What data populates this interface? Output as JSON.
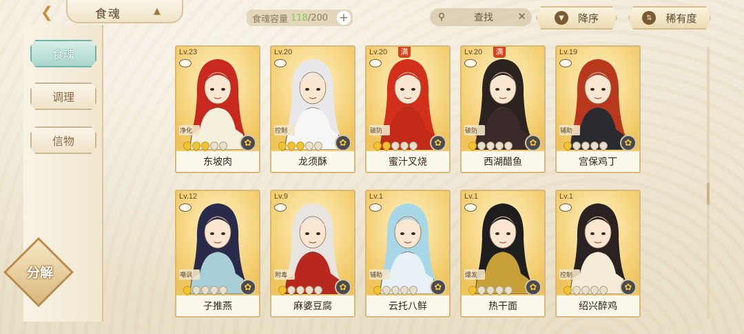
{
  "header": {
    "title": "食魂",
    "capacity_label": "食魂容量",
    "capacity_current": "118",
    "capacity_max": "/200",
    "capacity_add": "+",
    "search_label": "查找",
    "search_clear": "✕",
    "sort_order": "降序",
    "sort_by": "稀有度"
  },
  "sidebar": {
    "tabs": [
      {
        "label": "食魂",
        "active": true
      },
      {
        "label": "调理",
        "active": false
      },
      {
        "label": "信物",
        "active": false
      }
    ],
    "split_label": "分解"
  },
  "colors": {
    "accent_teal": "#a9d6cd",
    "gold": "#f0c866",
    "star_on": "#f1c234",
    "max_badge": "#d2431e",
    "capacity_current": "#8fc25a"
  },
  "cards": [
    {
      "level": "Lv.23",
      "full": "",
      "role": "净化",
      "stars": 3,
      "name": "东坡肉",
      "hair": "#c8281e",
      "outfit": "#f4f0dc"
    },
    {
      "level": "Lv.20",
      "full": "",
      "role": "控制",
      "stars": 3,
      "name": "龙须酥",
      "hair": "#e8e8ea",
      "outfit": "#f6f6f6"
    },
    {
      "level": "Lv.20",
      "full": "满",
      "role": "破防",
      "stars": 2,
      "name": "蜜汁叉烧",
      "hair": "#d2301c",
      "outfit": "#c42a1a"
    },
    {
      "level": "Lv.20",
      "full": "满",
      "role": "破防",
      "stars": 1,
      "name": "西湖醋鱼",
      "hair": "#2a2320",
      "outfit": "#3a2a2a"
    },
    {
      "level": "Lv.19",
      "full": "",
      "role": "辅助",
      "stars": 1,
      "name": "宫保鸡丁",
      "hair": "#b8381e",
      "outfit": "#2a2a30"
    },
    {
      "level": "Lv.12",
      "full": "",
      "role": "嘲讽",
      "stars": 1,
      "name": "子推燕",
      "hair": "#2a2a4a",
      "outfit": "#a8cfd8"
    },
    {
      "level": "Lv.9",
      "full": "",
      "role": "附毒",
      "stars": 1,
      "name": "麻婆豆腐",
      "hair": "#e8e4e0",
      "outfit": "#b8281e"
    },
    {
      "level": "Lv.1",
      "full": "",
      "role": "辅助",
      "stars": 1,
      "name": "云托八鲜",
      "hair": "#a8d8e8",
      "outfit": "#e8f2f6"
    },
    {
      "level": "Lv.1",
      "full": "",
      "role": "爆发",
      "stars": 1,
      "name": "热干面",
      "hair": "#1e1e1e",
      "outfit": "#c8a038"
    },
    {
      "level": "Lv.1",
      "full": "",
      "role": "控制",
      "stars": 1,
      "name": "绍兴醉鸡",
      "hair": "#2a2220",
      "outfit": "#f4ecd8"
    }
  ]
}
